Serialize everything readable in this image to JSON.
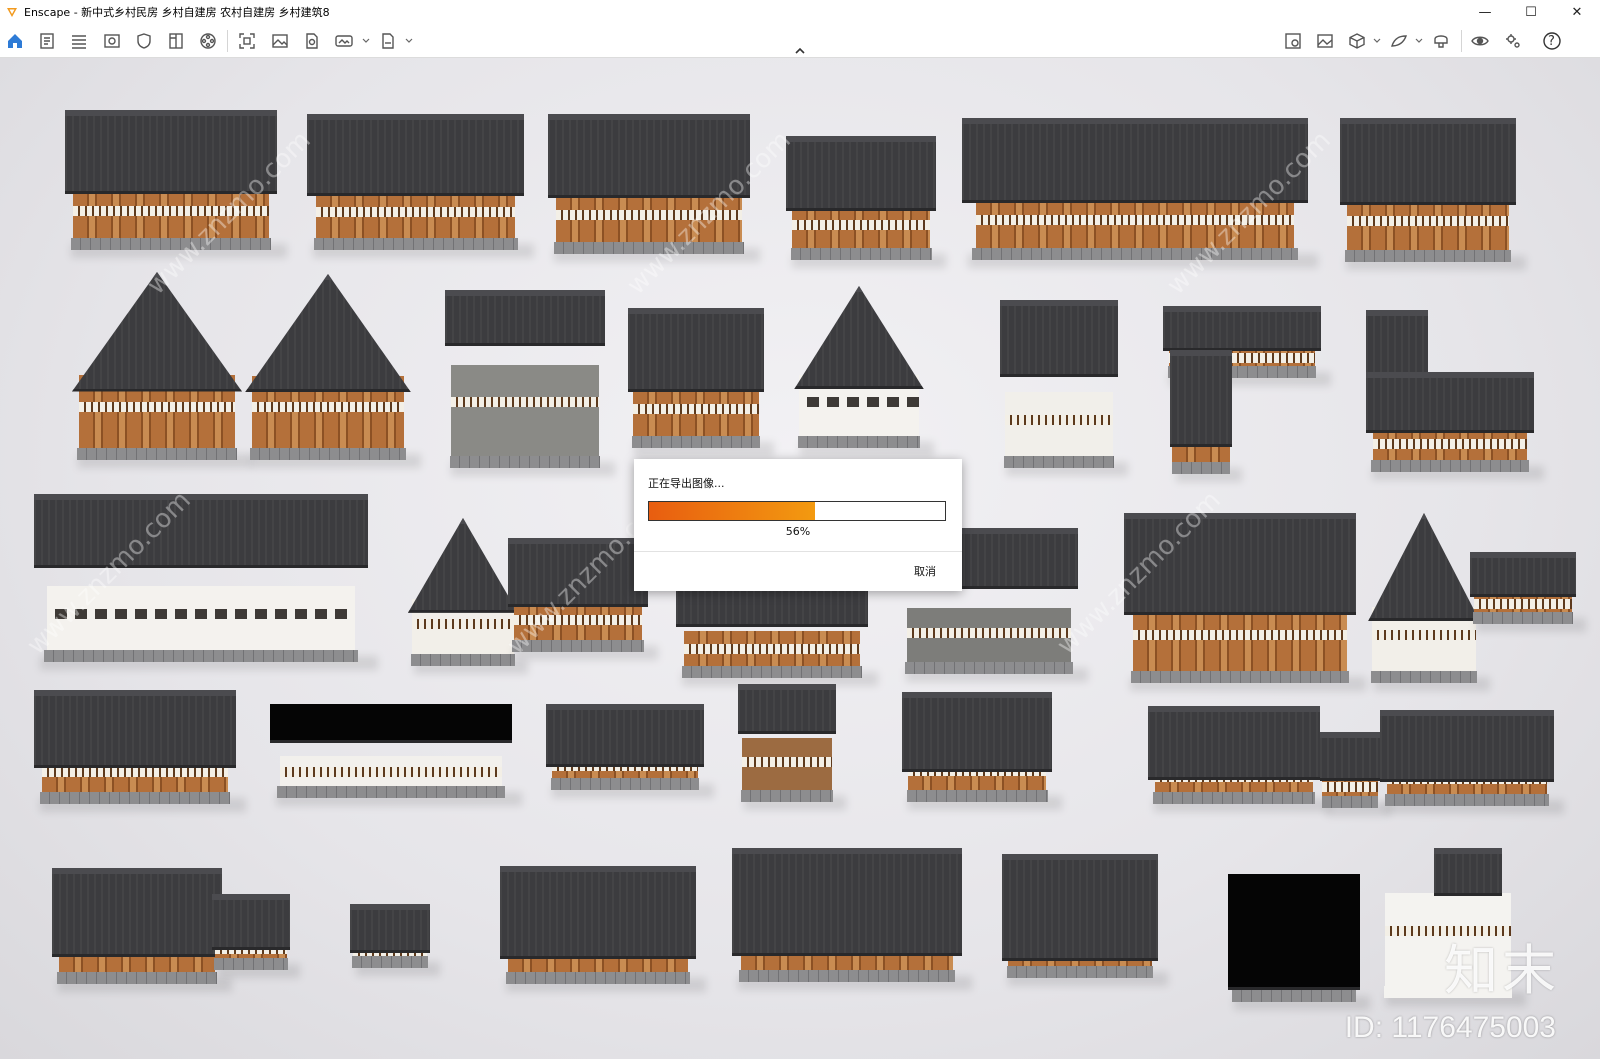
{
  "window": {
    "app_name": "Enscape",
    "title": "Enscape - 新中式乡村民房 乡村自建房 农村自建房 乡村建筑8",
    "controls": {
      "minimize": "—",
      "maximize": "☐",
      "close": "✕"
    }
  },
  "toolbar": {
    "left_icons": [
      "home-icon",
      "notes-icon",
      "bim-icon",
      "view-icon",
      "shield-icon",
      "book-icon",
      "film-icon",
      "screenshot-icon",
      "image-icon",
      "export-pdf-icon",
      "panorama-icon",
      "exe-export-icon"
    ],
    "right_icons": [
      "map-icon",
      "gallery-icon",
      "cube-icon",
      "material-icon",
      "vr-headset-icon",
      "visual-settings-icon",
      "settings-icon",
      "help-icon"
    ],
    "help_label": "?"
  },
  "dialog": {
    "message": "正在导出图像...",
    "progress_percent": 56,
    "progress_text": "56%",
    "cancel_label": "取消",
    "progress_color_start": "#e85d10",
    "progress_color_end": "#f39a10"
  },
  "watermark": {
    "site_text": "www.znzmo.com",
    "brand_cn": "知末",
    "id_text": "ID: 1176475003"
  },
  "colors": {
    "accent_blue": "#2e7bd6",
    "roof": "#3c3c3f",
    "timber": "#b4703a"
  }
}
